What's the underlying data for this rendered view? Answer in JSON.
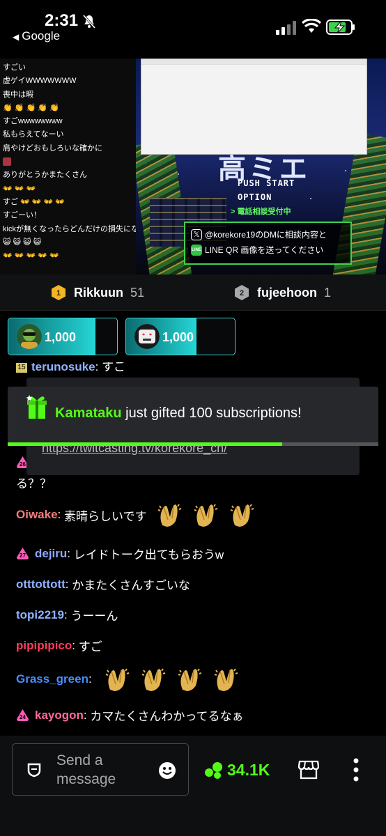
{
  "status_bar": {
    "time": "2:31",
    "back_label": "Google"
  },
  "overlay_chat": {
    "lines": [
      "すごい",
      "虚ゲイWWWWWWW",
      "喪中は暇",
      "👏 👏 👏 👏 👏",
      "すごwwwwwwww",
      "私もらえてなーい",
      "肩やけどおもしろいな確かに",
      "",
      "ありがとうかまたくさん",
      "👐 👐 👐",
      "すご 👐 👐 👐 👐",
      "すごーい！",
      "kickが無くなったらどんだけの損失になるんだろう",
      "😺 😺 😺 😺",
      "👐 👐 👐 👐 👐"
    ]
  },
  "video": {
    "title_art": "高ミエ",
    "push_start": "PUSH START",
    "option": "OPTION",
    "phone_consult": "> 電話相談受付中",
    "info_line1": "@korekore19のDMに相談内容と",
    "info_line2": "LINE QR 画像を送ってください"
  },
  "leaderboard": {
    "entries": [
      {
        "rank": "1",
        "name": "Rikkuun",
        "count": "51",
        "badge_color": "#f2b624"
      },
      {
        "rank": "2",
        "name": "fujeehoon",
        "count": "1",
        "badge_color": "#a8a8a8"
      }
    ]
  },
  "goals": [
    {
      "amount": "1,000",
      "fill_fraction": 0.8
    },
    {
      "amount": "1,000",
      "fill_fraction": 0.65
    }
  ],
  "chat": {
    "cut_top": {
      "user": "terunosuke",
      "text": "すご"
    },
    "cut_fragment": "る？？",
    "link_url": "https://twitcasting.tv/korekore_ch/",
    "messages": [
      {
        "user": "Oiwake",
        "color": "#f47b7b",
        "text": "素晴らしいです",
        "badge": null,
        "claps": 3
      },
      {
        "user": "dejiru",
        "color": "#8fa8ff",
        "text": "レイドトーク出てもらおうw",
        "badge": "27",
        "claps": 0
      },
      {
        "user": "otttottott",
        "color": "#8fb3ff",
        "text": "かまたくさんすごいな",
        "badge": null,
        "claps": 0
      },
      {
        "user": "topi2219",
        "color": "#8fb3ff",
        "text": "うーーん",
        "badge": null,
        "claps": 0
      },
      {
        "user": "pipipipico",
        "color": "#ff3b5c",
        "text": "すご",
        "badge": null,
        "claps": 0
      },
      {
        "user": "Grass_green",
        "color": "#4a8cff",
        "text": "",
        "badge": null,
        "claps": 4
      },
      {
        "user": "kayogon",
        "color": "#ff6b9e",
        "text": "カマたくさんわかってるなぁ",
        "badge": "24",
        "claps": 0
      }
    ],
    "cut_badge": "26"
  },
  "gift_banner": {
    "user": "Kamataku",
    "text": "just gifted 100 subscriptions!",
    "progress_fraction": 0.74
  },
  "bottom_bar": {
    "placeholder": "Send a message",
    "viewer_count": "34.1K"
  },
  "colors": {
    "accent_green": "#53fc18",
    "teal": "#25d6d6"
  }
}
